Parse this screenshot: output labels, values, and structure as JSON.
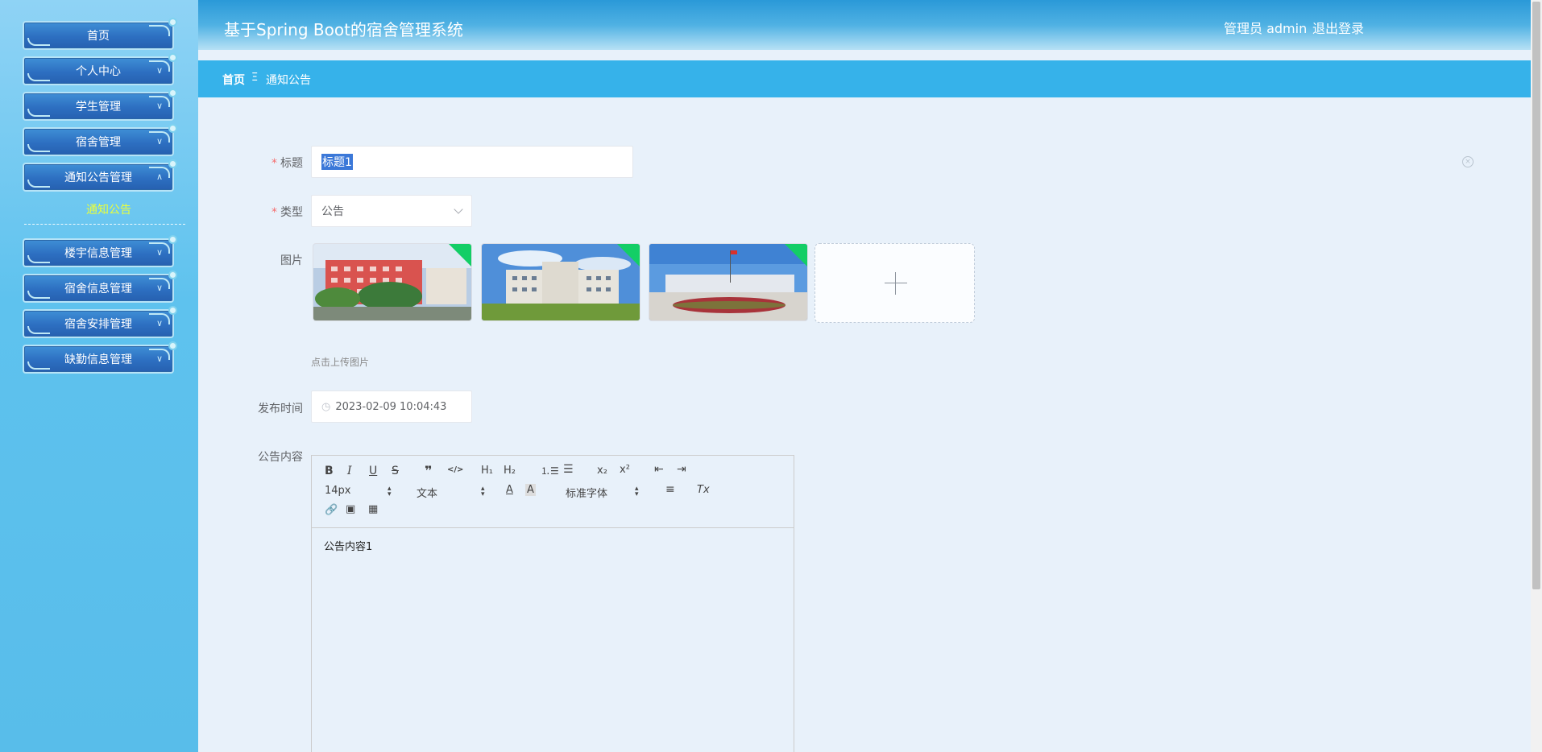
{
  "header": {
    "title": "基于Spring Boot的宿舍管理系统",
    "user": "管理员 admin",
    "logout": "退出登录"
  },
  "breadcrumb": {
    "home": "首页",
    "separator": "Ξ",
    "current": "通知公告"
  },
  "sidebar": {
    "items": [
      {
        "label": "首页"
      },
      {
        "label": "个人中心"
      },
      {
        "label": "学生管理"
      },
      {
        "label": "宿舍管理"
      },
      {
        "label": "通知公告管理"
      },
      {
        "label": "楼宇信息管理"
      },
      {
        "label": "宿舍信息管理"
      },
      {
        "label": "宿舍安排管理"
      },
      {
        "label": "缺勤信息管理"
      }
    ],
    "active_sub": "通知公告"
  },
  "form": {
    "title_label": "标题",
    "title_value": "标题1",
    "type_label": "类型",
    "type_value": "公告",
    "image_label": "图片",
    "upload_tip": "点击上传图片",
    "publish_time_label": "发布时间",
    "publish_time_value": "2023-02-09 10:04:43",
    "content_label": "公告内容",
    "content_value": "公告内容1"
  },
  "editor": {
    "font_size": "14px",
    "block_type": "文本",
    "font_family": "标准字体",
    "buttons": {
      "bold": "B",
      "italic": "I",
      "underline": "U",
      "strike": "S",
      "quote": "❞",
      "code": "</>",
      "h1": "H₁",
      "h2": "H₂",
      "sub": "x₂",
      "sup": "x²",
      "font_color": "A",
      "bg_color": "A",
      "clear": "Tx"
    }
  },
  "colors": {
    "accent": "#36b2ea",
    "header_top": "#2a99d8",
    "menu_button": "#2d6fc1",
    "active_sub": "#eaff3a",
    "required": "#f56c6c",
    "success_corner": "#13ce66"
  }
}
